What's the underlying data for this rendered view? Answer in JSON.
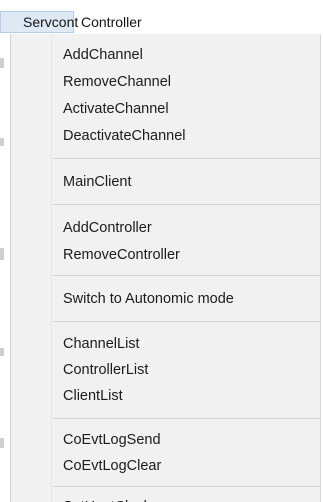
{
  "menubar": {
    "items": [
      {
        "label": "Servcont"
      },
      {
        "label": "Controller"
      }
    ]
  },
  "dropdown": {
    "items": [
      {
        "label": "AddChannel"
      },
      {
        "label": "RemoveChannel"
      },
      {
        "label": "ActivateChannel"
      },
      {
        "label": "DeactivateChannel"
      },
      {
        "label": "MainClient"
      },
      {
        "label": "AddController"
      },
      {
        "label": "RemoveController"
      },
      {
        "label": "Switch to Autonomic mode"
      },
      {
        "label": "ChannelList"
      },
      {
        "label": "ControllerList"
      },
      {
        "label": "ClientList"
      },
      {
        "label": "CoEvtLogSend"
      },
      {
        "label": "CoEvtLogClear"
      },
      {
        "label": "SetHostClock"
      }
    ]
  }
}
